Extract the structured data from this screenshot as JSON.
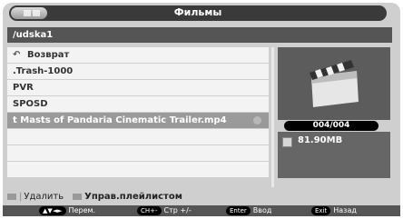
{
  "title": "Фильмы",
  "path": "/udska1",
  "files": [
    {
      "label": "Возврат",
      "icon": "back-arrow-icon"
    },
    {
      "label": ".Trash-1000"
    },
    {
      "label": "PVR"
    },
    {
      "label": "SPOSD"
    },
    {
      "label": "t Masts of Pandaria Cinematic Trailer.mp4",
      "selected": true
    }
  ],
  "counter": "004/004",
  "file_size": "81.90MB",
  "actions": {
    "delete": "Удалить",
    "playlist": "Управ.плейлистом"
  },
  "hints": [
    {
      "key": "▲▼◄►",
      "label": "Перем."
    },
    {
      "key": "CH+-",
      "label": "Стр +/-"
    },
    {
      "key": "Enter",
      "label": "Ввод"
    },
    {
      "key": "Exit",
      "label": "Назад"
    }
  ]
}
